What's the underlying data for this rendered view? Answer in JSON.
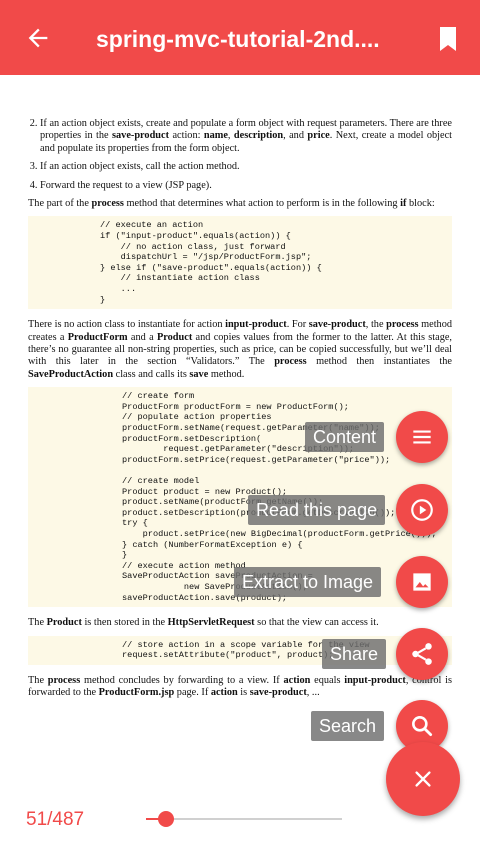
{
  "appbar": {
    "title": "spring-mvc-tutorial-2nd....",
    "back_icon": "arrow-back-icon",
    "bookmark_icon": "bookmark-icon",
    "color": "#f14a49"
  },
  "document": {
    "list": [
      [
        "If an action object exists, create and populate a form object with request parameters. There are three properties in the ",
        "save-product",
        " action: ",
        "name",
        ", ",
        "description",
        ", and ",
        "price",
        ". Next, create a model object and populate its properties from the form object."
      ],
      [
        "If an action object exists, call the action method."
      ],
      [
        "Forward the request to a view (JSP page)."
      ]
    ],
    "para1": [
      "The part of the ",
      "process",
      " method that determines what action to perform is in the following ",
      "if",
      " block:"
    ],
    "code1": "// execute an action\nif (\"input-product\".equals(action)) {\n    // no action class, just forward\n    dispatchUrl = \"/jsp/ProductForm.jsp\";\n} else if (\"save-product\".equals(action)) {\n    // instantiate action class\n    ...\n}",
    "para2": [
      "There is no action class to instantiate for action ",
      "input-product",
      ". For ",
      "save-product",
      ", the ",
      "process",
      " method creates a ",
      "ProductForm",
      " and a ",
      "Product",
      " and copies values from the former to the latter. At this stage, there’s no guarantee all non-string properties, such as price, can be copied successfully, but we’ll deal with this later in the section “Validators.” The ",
      "process",
      " method then instantiates the ",
      "SaveProductAction",
      " class and calls its ",
      "save",
      " method."
    ],
    "code2": "// create form\nProductForm productForm = new ProductForm();\n// populate action properties\nproductForm.setName(request.getParameter(\"name\"));\nproductForm.setDescription(\n        request.getParameter(\"description\"));\nproductForm.setPrice(request.getParameter(\"price\"));\n\n// create model\nProduct product = new Product();\nproduct.setName(productForm.getName());\nproduct.setDescription(productForm.getDescription());\ntry {\n    product.setPrice(new BigDecimal(productForm.getPrice()));\n} catch (NumberFormatException e) {\n}\n// execute action method\nSaveProductAction saveProductAction =\n            new SaveProductAction();\nsaveProductAction.save(product);",
    "para3": [
      "The ",
      "Product",
      " is then stored in the ",
      "HttpServletRequest",
      " so that the view can access it."
    ],
    "code3": "// store action in a scope variable for the view\nrequest.setAttribute(\"product\", product);",
    "para4": [
      "The ",
      "process",
      " method concludes by forwarding to a view. If ",
      "action",
      " equals ",
      "input-product",
      ", control is forwarded to the ",
      "ProductForm.jsp",
      " page. If ",
      "action",
      " is ",
      "save-product",
      ", ..."
    ]
  },
  "fab_menu": {
    "content": {
      "label": "Content",
      "icon": "menu-icon"
    },
    "read": {
      "label": "Read this page",
      "icon": "play-circle-icon"
    },
    "extract": {
      "label": "Extract to Image",
      "icon": "image-icon"
    },
    "share": {
      "label": "Share",
      "icon": "share-icon"
    },
    "search": {
      "label": "Search",
      "icon": "search-icon"
    },
    "close_icon": "close-icon"
  },
  "footer": {
    "page_counter": "51/487",
    "current_page": 51,
    "total_pages": 487
  }
}
